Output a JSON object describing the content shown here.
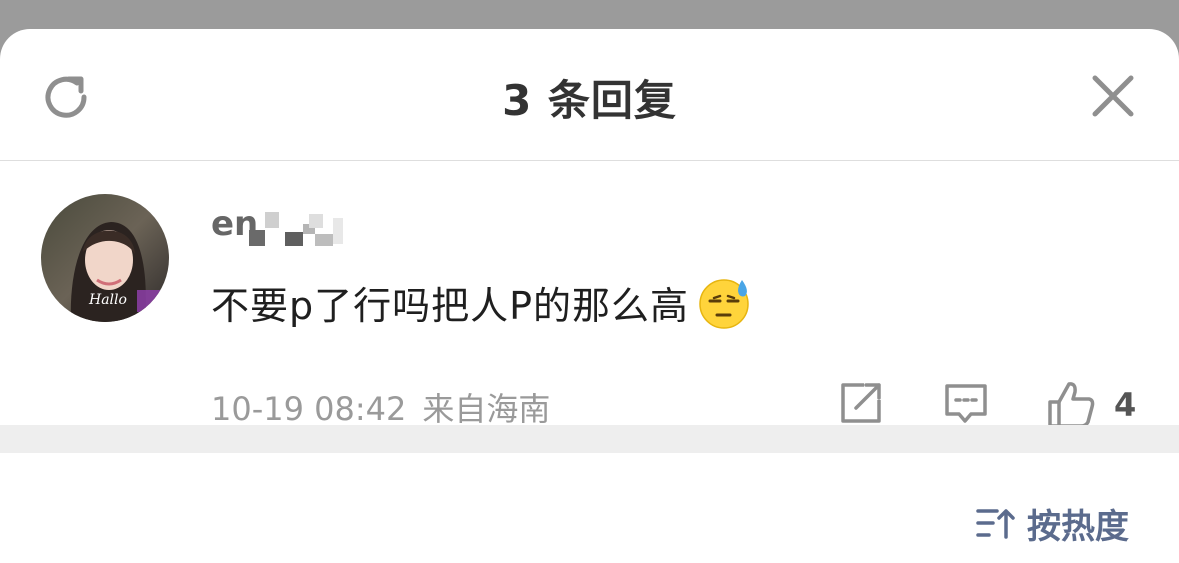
{
  "header": {
    "title": "3 条回复",
    "refresh_icon": "refresh-icon",
    "close_icon": "close-icon"
  },
  "comment": {
    "username": "en",
    "text": "不要p了行吗把人P的那么高",
    "emoji": "sweat-emoji",
    "time": "10-19 08:42",
    "location": "来自海南",
    "likes": "4",
    "avatar_text": "Hallo"
  },
  "footer": {
    "sort_label": "按热度",
    "sort_icon": "sort-icon"
  },
  "colors": {
    "backdrop": "#9b9b9b",
    "title": "#333333",
    "sort_accent": "#5b6b8d",
    "meta_text": "#9a9a9a"
  }
}
